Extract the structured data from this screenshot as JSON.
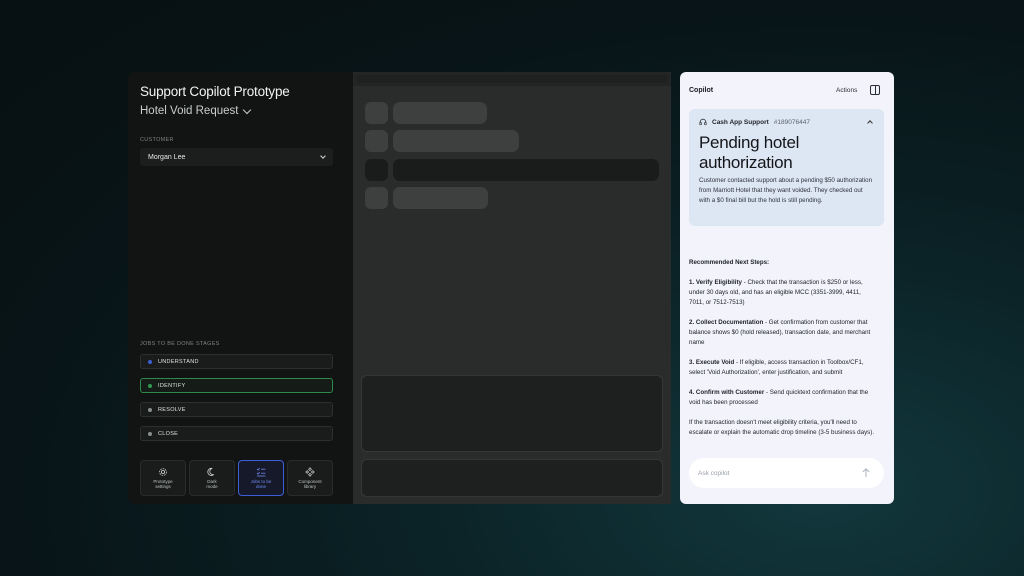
{
  "left": {
    "app_title": "Support Copilot Prototype",
    "subtitle": "Hotel Void Request",
    "customer_label": "CUSTOMER",
    "customer_value": "Morgan Lee",
    "stages_label": "JOBS TO BE DONE STAGES",
    "stages": [
      {
        "label": "UNDERSTAND",
        "color": "#3e5fd1",
        "active": false
      },
      {
        "label": "IDENTIFY",
        "color": "#2f9a4f",
        "active": true
      },
      {
        "label": "RESOLVE",
        "color": "#8a8f8f",
        "active": false
      },
      {
        "label": "CLOSE",
        "color": "#8a8f8f",
        "active": false
      }
    ],
    "tools": [
      {
        "icon": "gear-icon",
        "label1": "Prototype",
        "label2": "settings"
      },
      {
        "icon": "moon-icon",
        "label1": "Dark",
        "label2": "mode"
      },
      {
        "icon": "checklist-icon",
        "label1": "Jobs to be",
        "label2": "done"
      },
      {
        "icon": "component-icon",
        "label1": "Component",
        "label2": "library"
      }
    ]
  },
  "copilot": {
    "title": "Copilot",
    "actions": "Actions",
    "case": {
      "source": "Cash App Support",
      "id": "#189076447",
      "title": "Pending hotel authorization",
      "description": "Customer contacted support about a pending $50 authorization from Marriott Hotel that they want voided. They checked out with a $0 final bill but the hold is still pending."
    },
    "steps_heading": "Recommended Next Steps:",
    "steps": [
      {
        "title": "1. Verify Eligibility",
        "text": " - Check that the transaction is $250 or less, under 30 days old, and has an eligible MCC (3351-3999, 4411, 7011, or 7512-7513)"
      },
      {
        "title": "2. Collect Documentation",
        "text": " - Get confirmation from customer that balance shows $0 (hold released), transaction date, and merchant name"
      },
      {
        "title": "3. Execute Void",
        "text": " - If eligible, access transaction in Toolbox/CF1, select 'Void Authorization', enter justification, and submit"
      },
      {
        "title": "4. Confirm with Customer",
        "text": " - Send quicktext confirmation that the void has been processed"
      }
    ],
    "note": "If the transaction doesn't meet eligibility criteria, you'll need to escalate or explain the automatic drop timeline (3-5 business days).",
    "ask_placeholder": "Ask copilot"
  },
  "colors": {
    "accent_blue": "#3a5fd9",
    "accent_green": "#2e8a4c",
    "copilot_bg": "#f2f3fb",
    "case_card_bg": "#dde6f3"
  }
}
